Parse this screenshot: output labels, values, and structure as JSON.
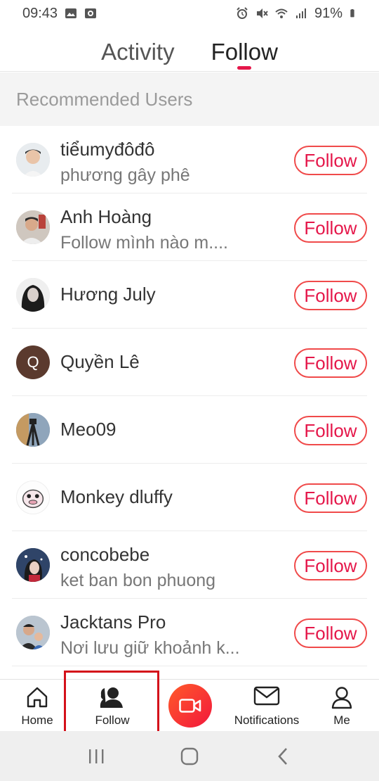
{
  "status_bar": {
    "time": "09:43",
    "battery": "91%",
    "icons": [
      "image-icon",
      "screen-record-icon",
      "alarm-icon",
      "mute-icon",
      "wifi-icon",
      "signal-icon",
      "battery-icon"
    ]
  },
  "tabs": [
    {
      "label": "Activity",
      "active": false
    },
    {
      "label": "Follow",
      "active": true
    }
  ],
  "section_header": "Recommended Users",
  "users": [
    {
      "name": "tiểumyđôđô",
      "subtitle": "phương gây phê",
      "button": "Follow",
      "avatar": "photo"
    },
    {
      "name": "Anh Hoàng",
      "subtitle": "Follow mình nào m....",
      "button": "Follow",
      "avatar": "photo"
    },
    {
      "name": "Hương July",
      "subtitle": "",
      "button": "Follow",
      "avatar": "photo"
    },
    {
      "name": "Quyền Lê",
      "subtitle": "",
      "button": "Follow",
      "avatar": "letter",
      "letter": "Q"
    },
    {
      "name": "Meo09",
      "subtitle": "",
      "button": "Follow",
      "avatar": "photo"
    },
    {
      "name": "Monkey dluffy",
      "subtitle": "",
      "button": "Follow",
      "avatar": "photo"
    },
    {
      "name": "concobebe",
      "subtitle": "ket ban bon phuong",
      "button": "Follow",
      "avatar": "photo"
    },
    {
      "name": "Jacktans Pro",
      "subtitle": "Nơi lưu giữ khoảnh k...",
      "button": "Follow",
      "avatar": "photo"
    }
  ],
  "bottom_nav": {
    "home": "Home",
    "follow": "Follow",
    "notifications": "Notifications",
    "me": "Me"
  },
  "colors": {
    "accent": "#e5174a",
    "highlight": "#d4101a",
    "record_gradient_start": "#ff5a2a",
    "record_gradient_end": "#f2183c"
  }
}
